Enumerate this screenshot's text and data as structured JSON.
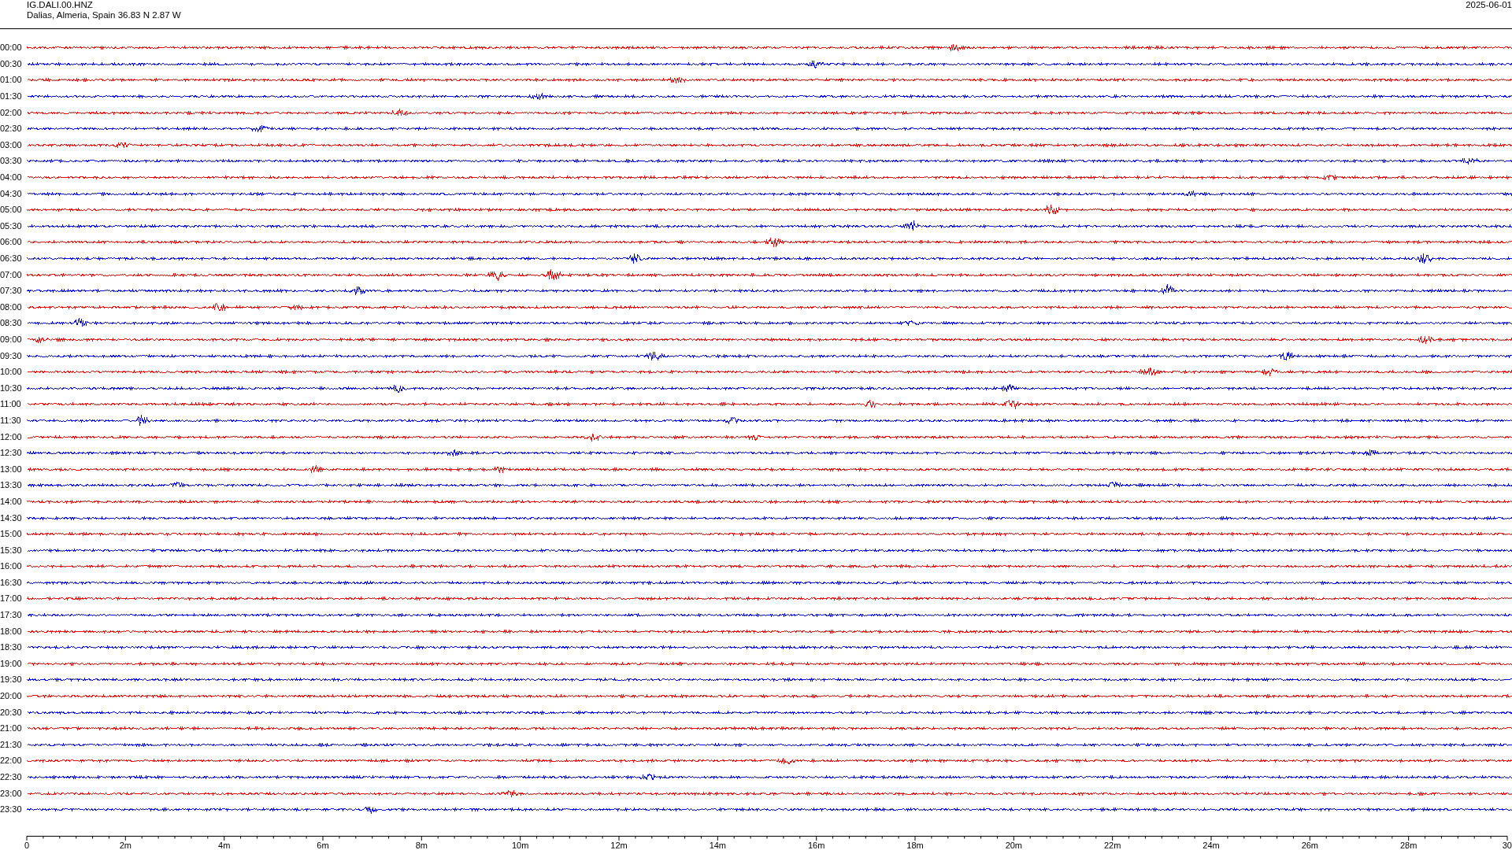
{
  "header": {
    "station": "IG.DALI.00.HNZ",
    "location": "Dalias, Almeria, Spain  36.83 N 2.87 W",
    "date": "2025-06-01"
  },
  "traces": [
    {
      "label": "00:00",
      "color": "#ff0000"
    },
    {
      "label": "00:30",
      "color": "#0000ff"
    },
    {
      "label": "01:00",
      "color": "#ff0000"
    },
    {
      "label": "01:30",
      "color": "#0000ff"
    },
    {
      "label": "02:00",
      "color": "#ff0000"
    },
    {
      "label": "02:30",
      "color": "#0000ff"
    },
    {
      "label": "03:00",
      "color": "#ff0000"
    },
    {
      "label": "03:30",
      "color": "#0000ff"
    },
    {
      "label": "04:00",
      "color": "#ff0000"
    },
    {
      "label": "04:30",
      "color": "#0000ff"
    },
    {
      "label": "05:00",
      "color": "#ff0000"
    },
    {
      "label": "05:30",
      "color": "#0000ff"
    },
    {
      "label": "06:00",
      "color": "#ff0000"
    },
    {
      "label": "06:30",
      "color": "#0000ff"
    },
    {
      "label": "07:00",
      "color": "#ff0000"
    },
    {
      "label": "07:30",
      "color": "#0000ff"
    },
    {
      "label": "08:00",
      "color": "#ff0000"
    },
    {
      "label": "08:30",
      "color": "#0000ff"
    },
    {
      "label": "09:00",
      "color": "#ff0000"
    },
    {
      "label": "09:30",
      "color": "#0000ff"
    },
    {
      "label": "10:00",
      "color": "#ff0000"
    },
    {
      "label": "10:30",
      "color": "#0000ff"
    },
    {
      "label": "11:00",
      "color": "#ff0000"
    },
    {
      "label": "11:30",
      "color": "#0000ff"
    },
    {
      "label": "12:00",
      "color": "#ff0000"
    },
    {
      "label": "12:30",
      "color": "#0000ff"
    },
    {
      "label": "13:00",
      "color": "#ff0000"
    },
    {
      "label": "13:30",
      "color": "#0000ff"
    },
    {
      "label": "14:00",
      "color": "#ff0000"
    },
    {
      "label": "14:30",
      "color": "#0000ff"
    },
    {
      "label": "15:00",
      "color": "#ff0000"
    },
    {
      "label": "15:30",
      "color": "#0000ff"
    },
    {
      "label": "16:00",
      "color": "#ff0000"
    },
    {
      "label": "16:30",
      "color": "#0000ff"
    },
    {
      "label": "17:00",
      "color": "#ff0000"
    },
    {
      "label": "17:30",
      "color": "#0000ff"
    },
    {
      "label": "18:00",
      "color": "#ff0000"
    },
    {
      "label": "18:30",
      "color": "#0000ff"
    },
    {
      "label": "19:00",
      "color": "#ff0000"
    },
    {
      "label": "19:30",
      "color": "#0000ff"
    },
    {
      "label": "20:00",
      "color": "#ff0000"
    },
    {
      "label": "20:30",
      "color": "#0000ff"
    },
    {
      "label": "21:00",
      "color": "#ff0000"
    },
    {
      "label": "21:30",
      "color": "#0000ff"
    },
    {
      "label": "22:00",
      "color": "#ff0000"
    },
    {
      "label": "22:30",
      "color": "#0000ff"
    },
    {
      "label": "23:00",
      "color": "#ff0000"
    },
    {
      "label": "23:30",
      "color": "#0000ff"
    }
  ],
  "x_axis": {
    "ticks": [
      "0",
      "2m",
      "4m",
      "6m",
      "8m",
      "10m",
      "12m",
      "14m",
      "16m",
      "18m",
      "20m",
      "22m",
      "24m",
      "26m",
      "28m",
      "30"
    ]
  }
}
